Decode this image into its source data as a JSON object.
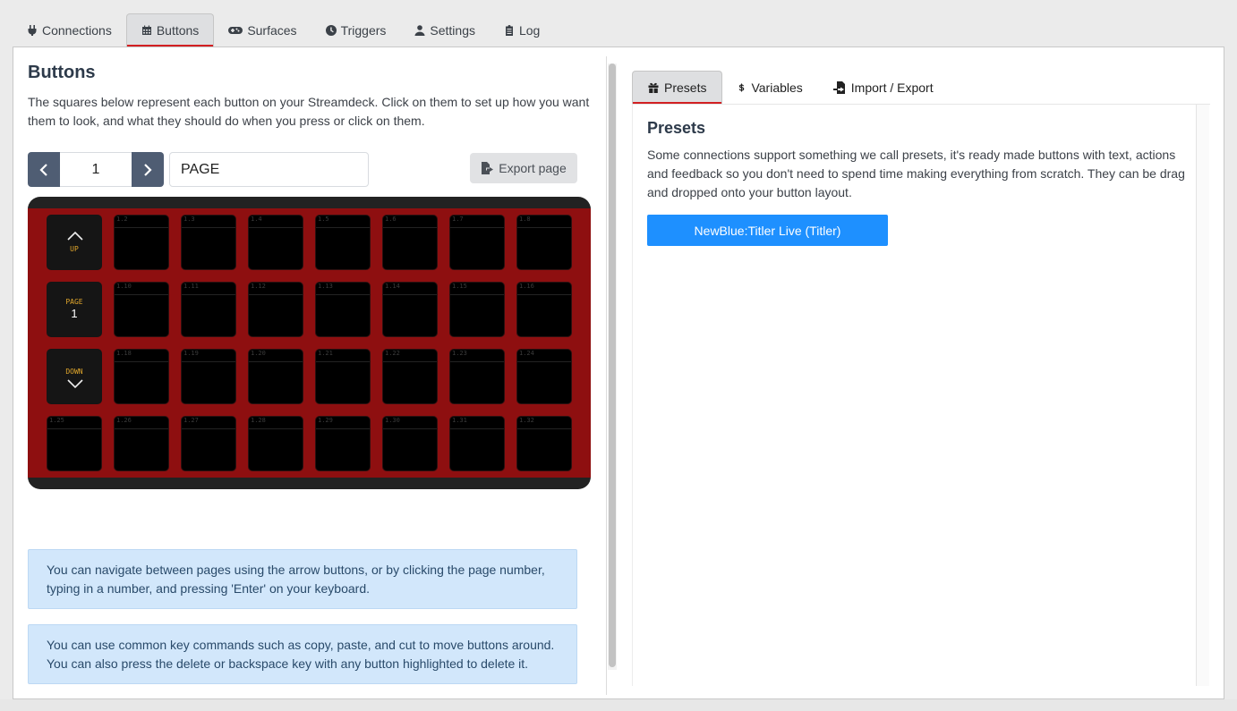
{
  "nav": {
    "tabs": [
      {
        "label": "Connections",
        "icon": "plug-icon"
      },
      {
        "label": "Buttons",
        "icon": "calendar-grid-icon",
        "active": true
      },
      {
        "label": "Surfaces",
        "icon": "gamepad-icon"
      },
      {
        "label": "Triggers",
        "icon": "clock-icon"
      },
      {
        "label": "Settings",
        "icon": "user-cog-icon"
      },
      {
        "label": "Log",
        "icon": "clipboard-icon"
      }
    ]
  },
  "buttons": {
    "title": "Buttons",
    "intro": "The squares below represent each button on your Streamdeck. Click on them to set up how you want them to look, and what they should do when you press or click on them.",
    "page_number": "1",
    "page_name": "PAGE",
    "export_label": "Export page",
    "deck_color": "#8e0f10",
    "nav_keys": {
      "up_label": "UP",
      "page_label": "PAGE",
      "page_number": "1",
      "down_label": "DOWN"
    },
    "key_labels": [
      "1.2",
      "1.3",
      "1.4",
      "1.5",
      "1.6",
      "1.7",
      "1.8",
      "1.10",
      "1.11",
      "1.12",
      "1.13",
      "1.14",
      "1.15",
      "1.16",
      "1.18",
      "1.19",
      "1.20",
      "1.21",
      "1.22",
      "1.23",
      "1.24",
      "1.25",
      "1.26",
      "1.27",
      "1.28",
      "1.29",
      "1.30",
      "1.31",
      "1.32"
    ],
    "tips": [
      "You can navigate between pages using the arrow buttons, or by clicking the page number, typing in a number, and pressing 'Enter' on your keyboard.",
      "You can use common key commands such as copy, paste, and cut to move buttons around. You can also press the delete or backspace key with any button highlighted to delete it."
    ]
  },
  "right": {
    "tabs": [
      {
        "label": "Presets",
        "icon": "gift-icon",
        "active": true
      },
      {
        "label": "Variables",
        "icon": "dollar-icon"
      },
      {
        "label": "Import / Export",
        "icon": "file-import-icon"
      }
    ],
    "presets_title": "Presets",
    "presets_text": "Some connections support something we call presets, it's ready made buttons with text, actions and feedback so you don't need to spend time making everything from scratch. They can be drag and dropped onto your button layout.",
    "preset_button": "NewBlue:Titler Live (Titler)",
    "accent_color": "#1e90ff",
    "active_tab_underline": "#d21f22"
  }
}
